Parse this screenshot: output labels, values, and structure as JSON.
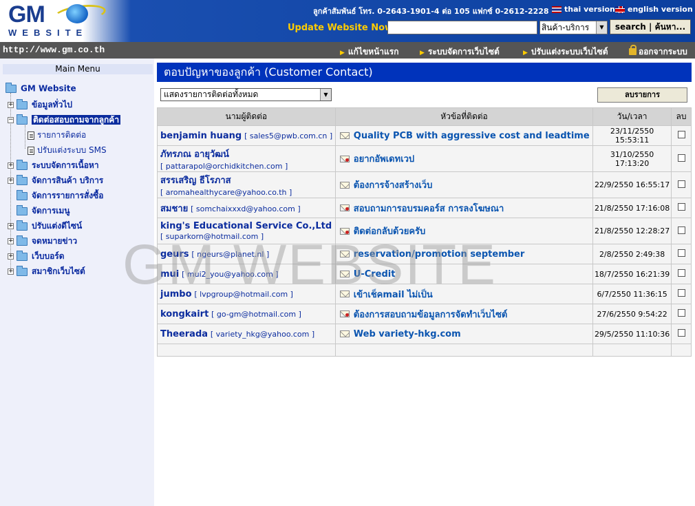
{
  "header": {
    "logo_top": "GM",
    "logo_bottom": "WEBSITE",
    "contact": "ลูกค้าสัมพันธ์ โทร. 0-2643-1901-4 ต่อ 105 แฟกซ์ 0-2612-2228",
    "thai_version": "thai version",
    "english_version": "english version",
    "update_label": "Update Website Now!",
    "search_value": "",
    "search_select": "สินค้า-บริการ",
    "search_button": "search | ค้นหา..."
  },
  "navbar": {
    "url": "http://www.gm.co.th",
    "links": [
      "แก้ไขหน้าแรก",
      "ระบบจัดการเว็บไซต์",
      "ปรับแต่งระบบเว็บไซต์",
      "ออกจากระบบ"
    ]
  },
  "sidebar": {
    "title": "Main Menu",
    "root": "GM Website",
    "items": [
      "ข้อมูลทั่วไป",
      "ติดต่อสอบถามจากลูกค้า",
      "รายการติดต่อ",
      "ปรับแต่งระบบ SMS",
      "ระบบจัดการเนื้อหา",
      "จัดการสินค้า บริการ",
      "จัดการรายการสั่งซื้อ",
      "จัดการเมนู",
      "ปรับแต่งดีไซน์",
      "จดหมายข่าว",
      "เว็บบอร์ด",
      "สมาชิกเว็บไซต์"
    ]
  },
  "main": {
    "title": "ตอบปัญหาของลูกค้า (Customer Contact)",
    "filter": "แสดงรายการติดต่อทั้งหมด",
    "delete_button": "ลบรายการ",
    "columns": [
      "นามผู้ติดต่อ",
      "หัวข้อที่ติดต่อ",
      "วัน/เวลา",
      "ลบ"
    ],
    "rows": [
      {
        "name": "benjamin huang",
        "email": "[ sales5@pwb.com.cn ]",
        "subject": "Quality PCB with aggressive cost and leadtime",
        "date": "23/11/2550 15:53:11",
        "new": false,
        "inline": true
      },
      {
        "name": "ภัทรภณ อายุวัฒน์",
        "email": "[ pattarapol@orchidkitchen.com ]",
        "subject": "อยากอัพเดทเวป",
        "date": "31/10/2550 17:13:20",
        "new": true,
        "inline": false
      },
      {
        "name": "สรรเสริญ ธีโรภาส",
        "email": "[ aromahealthycare@yahoo.co.th ]",
        "subject": "ต้องการจ้างสร้างเว็บ",
        "date": "22/9/2550 16:55:17",
        "new": false,
        "inline": false
      },
      {
        "name": "สมชาย",
        "email": "[ somchaixxxd@yahoo.com ]",
        "subject": "สอบถามการอบรมคอร์ส การลงโฆษณา",
        "date": "21/8/2550 17:16:08",
        "new": true,
        "inline": true
      },
      {
        "name": "king's Educational Service Co.,Ltd",
        "email": "[ suparkorn@hotmail.com ]",
        "subject": "ติดต่อกลับด้วยครับ",
        "date": "21/8/2550 12:28:27",
        "new": true,
        "inline": false
      },
      {
        "name": "geurs",
        "email": "[ ngeurs@planet.nl ]",
        "subject": "reservation/promotion september",
        "date": "2/8/2550 2:49:38",
        "new": false,
        "inline": true
      },
      {
        "name": "mui",
        "email": "[ mui2_you@yahoo.com ]",
        "subject": "U-Credit",
        "date": "18/7/2550 16:21:39",
        "new": false,
        "inline": true
      },
      {
        "name": "jumbo",
        "email": "[ lvpgroup@hotmail.com ]",
        "subject": "เข้าเช็คmail ไม่เป็น",
        "date": "6/7/2550 11:36:15",
        "new": false,
        "inline": true
      },
      {
        "name": "kongkairt",
        "email": "[ go-gm@hotmail.com ]",
        "subject": "ต้องการสอบถามข้อมูลการจัดทำเว็บไซต์",
        "date": "27/6/2550 9:54:22",
        "new": true,
        "inline": true
      },
      {
        "name": "Theerada",
        "email": "[ variety_hkg@yahoo.com ]",
        "subject": "Web variety-hkg.com",
        "date": "29/5/2550 11:10:36",
        "new": false,
        "inline": true
      }
    ]
  },
  "watermark": "GM WEBSITE"
}
